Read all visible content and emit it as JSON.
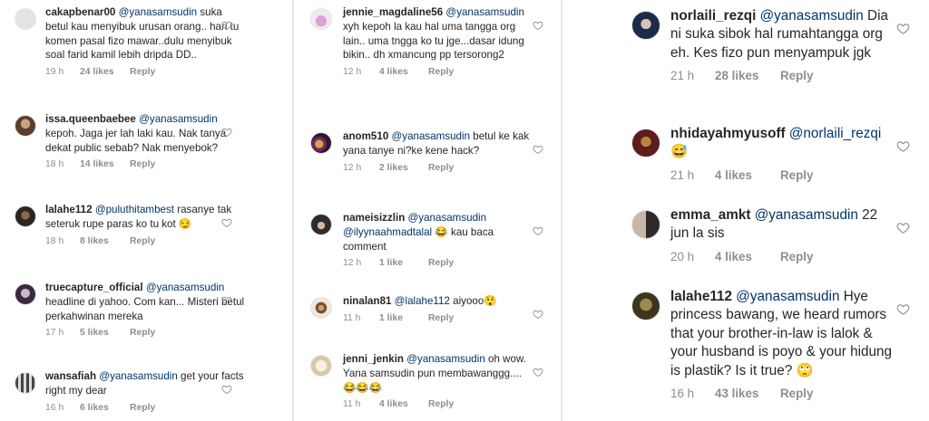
{
  "columns": [
    {
      "comments": [
        {
          "username": "cakapbenar00",
          "mention": "@yanasamsudin",
          "text": " suka betul kau menyibuk urusan orang.. hari tu komen pasal fizo mawar..dulu menyibuk soal farid kamil lebih dripda DD..",
          "time": "19 h",
          "likes": "24 likes",
          "reply": "Reply",
          "avatar": "av-grey"
        },
        {
          "username": "issa.queenbaebee",
          "mention": "@yanasamsudin",
          "text": " kepoh. Jaga jer lah laki kau. Nak tanya dekat public sebab? Nak menyebok?",
          "time": "18 h",
          "likes": "14 likes",
          "reply": "Reply",
          "avatar": "av-brown"
        },
        {
          "username": "lalahe112",
          "mention": "@puluthitambest",
          "text": " rasanye tak seteruk rupe paras ko tu kot 😏",
          "time": "18 h",
          "likes": "8 likes",
          "reply": "Reply",
          "avatar": "av-dark"
        },
        {
          "username": "truecapture_official",
          "mention": "@yanasamsudin",
          "text": " headline di yahoo. Com kan... Misteri betul perkahwinan mereka",
          "time": "17 h",
          "likes": "5 likes",
          "reply": "Reply",
          "avatar": "av-purple"
        },
        {
          "username": "wansafiah",
          "mention": "@yanasamsudin",
          "text": " get your facts right my dear",
          "time": "16 h",
          "likes": "6 likes",
          "reply": "Reply",
          "avatar": "av-stripes"
        }
      ]
    },
    {
      "comments": [
        {
          "username": "jennie_magdaline56",
          "mention": "@yanasamsudin",
          "text": " xyh kepoh la kau hal uma tangga org lain.. uma tngga ko tu jge...dasar idung bikin.. dh xmancung pp tersorong2",
          "time": "12 h",
          "likes": "4 likes",
          "reply": "Reply",
          "avatar": "av-pink"
        },
        {
          "username": "anom510",
          "mention": "@yanasamsudin",
          "text": " betul ke kak yana tanye ni?ke kene hack?",
          "time": "12 h",
          "likes": "2 likes",
          "reply": "Reply",
          "avatar": "av-gold"
        },
        {
          "username": "nameisizzlin",
          "mention": "@yanasamsudin @ilyynaahmadtalal",
          "text": " 😂 kau baca comment",
          "time": "12 h",
          "likes": "1 like",
          "reply": "Reply",
          "avatar": "av-hijab"
        },
        {
          "username": "ninalan81",
          "mention": "@lalahe112",
          "text": " aiyooo😲",
          "time": "11 h",
          "likes": "1 like",
          "reply": "Reply",
          "avatar": "av-cookie"
        },
        {
          "username": "jenni_jenkin",
          "mention": "@yanasamsudin",
          "text": " oh wow. Yana samsudin pun membawanggg....😂😂😂",
          "time": "11 h",
          "likes": "4 likes",
          "reply": "Reply",
          "avatar": "av-sand"
        }
      ]
    },
    {
      "comments": [
        {
          "username": "norlaili_rezqi",
          "mention": "@yanasamsudin",
          "text": " Dia ni suka sibok hal rumahtangga org eh.  Kes fizo pun menyampuk jgk",
          "time": "21 h",
          "likes": "28 likes",
          "reply": "Reply",
          "avatar": "av-navy"
        },
        {
          "username": "nhidayahmyusoff",
          "mention": "@norlaili_rezqi",
          "text": " 😅",
          "time": "21 h",
          "likes": "4 likes",
          "reply": "Reply",
          "avatar": "av-red"
        },
        {
          "username": "emma_amkt",
          "mention": "@yanasamsudin",
          "text": " 22 jun la sis",
          "time": "20 h",
          "likes": "4 likes",
          "reply": "Reply",
          "avatar": "av-pair"
        },
        {
          "username": "lalahe112",
          "mention": "@yanasamsudin",
          "text": " Hye princess bawang, we heard rumors that your brother-in-law is lalok & your husband is poyo & your hidung is plastik? Is it true? 🙄",
          "time": "16 h",
          "likes": "43 likes",
          "reply": "Reply",
          "avatar": "av-olive"
        }
      ]
    }
  ]
}
